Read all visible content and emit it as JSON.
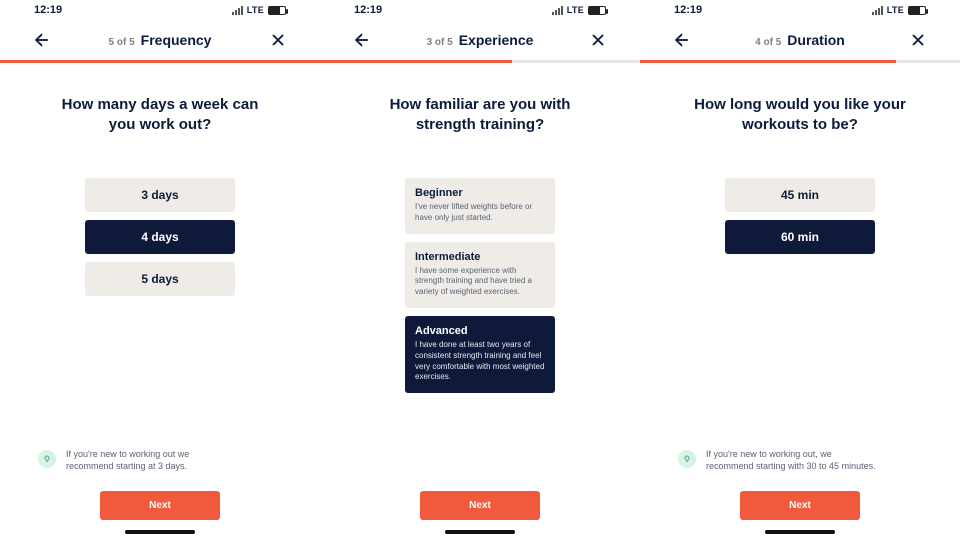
{
  "status": {
    "time": "12:19",
    "carrier_label": "LTE"
  },
  "screens": [
    {
      "step": "5 of 5",
      "title": "Frequency",
      "progress_pct": 100,
      "question": "How many days a week can you work out?",
      "option_style": "simple",
      "options": [
        {
          "label": "3 days",
          "selected": false
        },
        {
          "label": "4 days",
          "selected": true
        },
        {
          "label": "5 days",
          "selected": false
        }
      ],
      "tip": "If you're new to working out we recommend starting at 3 days.",
      "next": "Next"
    },
    {
      "step": "3 of 5",
      "title": "Experience",
      "progress_pct": 60,
      "question": "How familiar are you with strength training?",
      "option_style": "rich",
      "options": [
        {
          "label": "Beginner",
          "desc": "I've never lifted weights before or have only just started.",
          "selected": false
        },
        {
          "label": "Intermediate",
          "desc": "I have some experience with strength training and have tried a variety of weighted exercises.",
          "selected": false
        },
        {
          "label": "Advanced",
          "desc": "I have done at least two years of consistent strength training and feel very comfortable with most weighted exercises.",
          "selected": true
        }
      ],
      "tip": "",
      "next": "Next"
    },
    {
      "step": "4 of 5",
      "title": "Duration",
      "progress_pct": 80,
      "question": "How long would you like your workouts to be?",
      "option_style": "simple",
      "options": [
        {
          "label": "45 min",
          "selected": false
        },
        {
          "label": "60 min",
          "selected": true
        }
      ],
      "tip": "If you're new to working out, we recommend starting with 30 to 45 minutes.",
      "next": "Next"
    }
  ]
}
